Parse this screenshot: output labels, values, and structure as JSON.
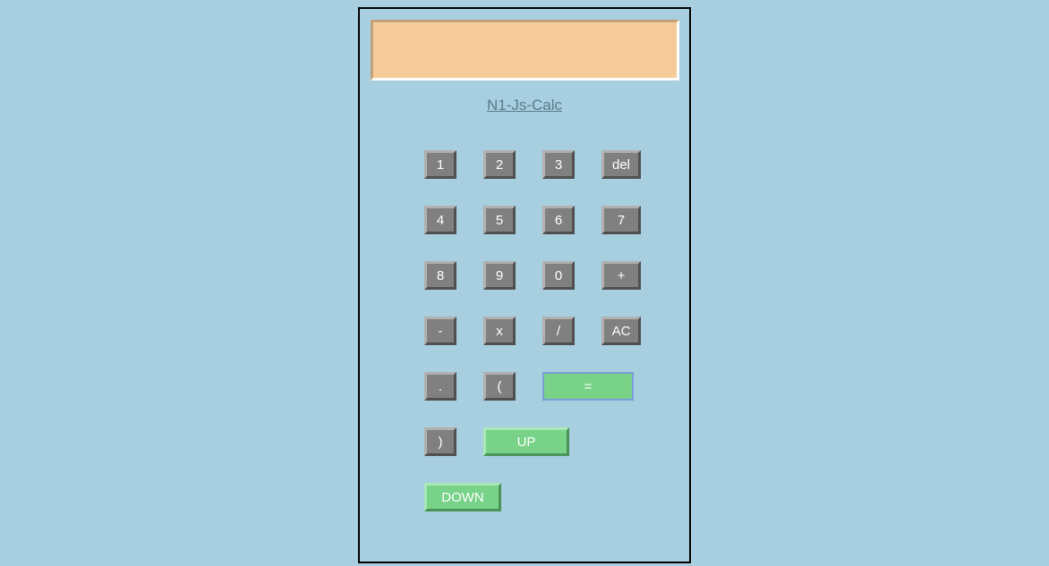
{
  "title": "N1-Js-Calc",
  "display": "",
  "buttons": {
    "row1": [
      "1",
      "2",
      "3",
      "del"
    ],
    "row2": [
      "4",
      "5",
      "6",
      "7"
    ],
    "row3": [
      "8",
      "9",
      "0",
      "+"
    ],
    "row4": [
      "-",
      "x",
      "/",
      "AC"
    ],
    "row5": [
      ".",
      "(",
      "="
    ],
    "row6": [
      ")",
      "UP"
    ],
    "row7": [
      "DOWN"
    ]
  }
}
